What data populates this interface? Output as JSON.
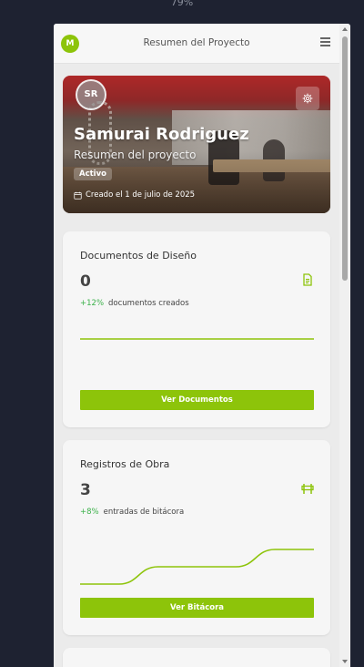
{
  "browser": {
    "zoom": "79%"
  },
  "header": {
    "avatar_initial": "M",
    "title": "Resumen del Proyecto",
    "menu_icon": "hamburger-menu-icon"
  },
  "hero": {
    "avatar_initials": "SR",
    "name": "Samurai Rodriguez",
    "subtitle": "Resumen del proyecto",
    "status": "Activo",
    "created": "Creado el 1 de julio de 2025",
    "settings_icon": "gear-icon",
    "calendar_icon": "calendar-icon"
  },
  "cards": [
    {
      "title": "Documentos de Diseño",
      "value": "0",
      "change_pct": "+12%",
      "change_label": "documentos creados",
      "icon": "document-icon",
      "button_label": "Ver Documentos",
      "chart_data": {
        "type": "line",
        "values": [
          0,
          0,
          0,
          0,
          0,
          0,
          0
        ]
      }
    },
    {
      "title": "Registros de Obra",
      "value": "3",
      "change_pct": "+8%",
      "change_label": "entradas de bitácora",
      "icon": "construction-barrier-icon",
      "button_label": "Ver Bitácora",
      "chart_data": {
        "type": "line",
        "values": [
          0,
          0,
          1,
          1,
          1,
          2,
          2
        ]
      }
    }
  ],
  "colors": {
    "accent": "#8dc40a",
    "positive": "#3bb14a",
    "background": "#1e2231"
  }
}
